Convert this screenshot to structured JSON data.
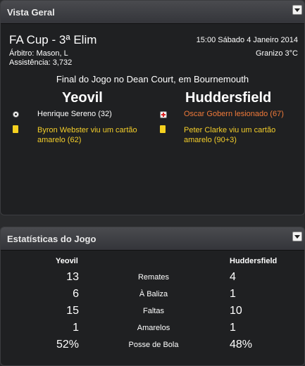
{
  "overview": {
    "title": "Vista Geral",
    "competition": "FA Cup - 3ª Elim",
    "referee": "Árbitro: Mason, L",
    "attendance": "Assistência: 3,732",
    "datetime": "15:00 Sábado 4 Janeiro 2014",
    "weather": "Granizo 3°C",
    "result_line": "Final do Jogo no Dean Court, em Bournemouth",
    "home_team": "Yeovil",
    "away_team": "Huddersfield",
    "home_events": [
      {
        "icon": "goal-ball-icon",
        "text": "Henrique Sereno (32)"
      },
      {
        "icon": "yellow-card-icon",
        "text": "Byron Webster viu um cartão amarelo (62)"
      }
    ],
    "away_events": [
      {
        "icon": "injury-icon",
        "text": "Oscar Gobern lesionado (67)"
      },
      {
        "icon": "yellow-card-icon",
        "text": "Peter Clarke viu um cartão amarelo (90+3)"
      }
    ]
  },
  "stats": {
    "title": "Estatísticas do Jogo",
    "home_header": "Yeovil",
    "away_header": "Huddersfield",
    "rows": [
      {
        "label": "Remates",
        "home": "13",
        "away": "4"
      },
      {
        "label": "À Baliza",
        "home": "6",
        "away": "1"
      },
      {
        "label": "Faltas",
        "home": "15",
        "away": "10"
      },
      {
        "label": "Amarelos",
        "home": "1",
        "away": "1"
      },
      {
        "label": "Posse de Bola",
        "home": "52%",
        "away": "48%"
      }
    ]
  },
  "colors": {
    "background": "#2a2b2d",
    "panel": "#1f2022",
    "card_yellow": "#f6d11f",
    "event_yellow_text": "#f5cf2a",
    "event_orange_text": "#f07a3a"
  }
}
